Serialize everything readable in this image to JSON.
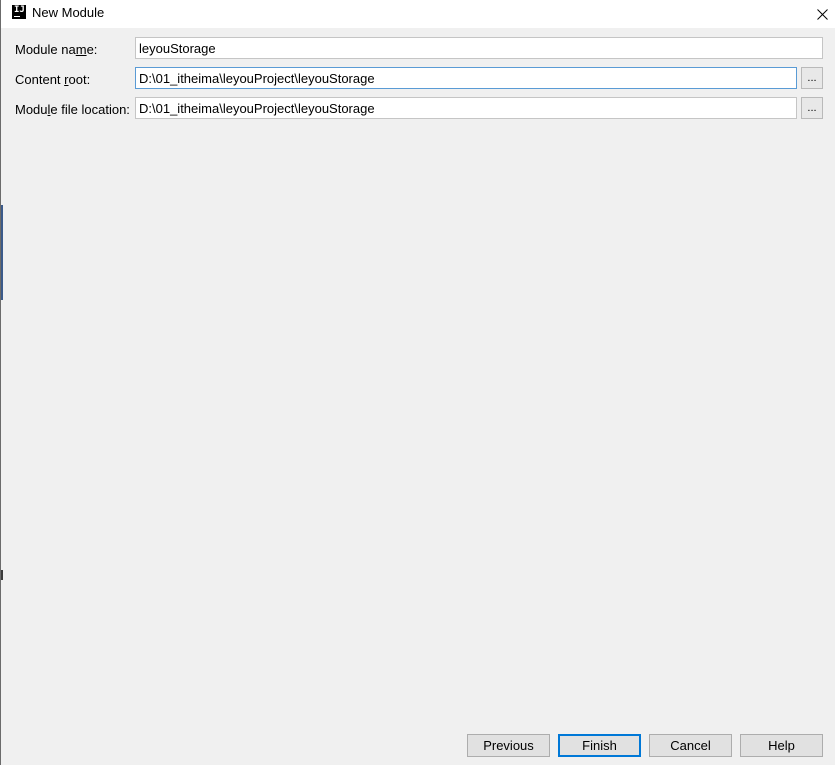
{
  "window": {
    "title": "New Module",
    "app_icon_letters": "IJ"
  },
  "form": {
    "module_name": {
      "label_before": "Module na",
      "label_mnemonic": "m",
      "label_after": "e:",
      "value": "leyouStorage"
    },
    "content_root": {
      "label_before": "Content ",
      "label_mnemonic": "r",
      "label_after": "oot:",
      "value": "D:\\01_itheima\\leyouProject\\leyouStorage",
      "browse_label": "..."
    },
    "module_file_location": {
      "label_before": "Modu",
      "label_mnemonic": "l",
      "label_after": "e file location:",
      "value": "D:\\01_itheima\\leyouProject\\leyouStorage",
      "browse_label": "..."
    }
  },
  "buttons": {
    "previous": "Previous",
    "finish": "Finish",
    "cancel": "Cancel",
    "help": "Help"
  },
  "colors": {
    "dialog_background": "#f0f0f0",
    "focus_border": "#5a9bd5",
    "default_button_border": "#0078d7"
  }
}
